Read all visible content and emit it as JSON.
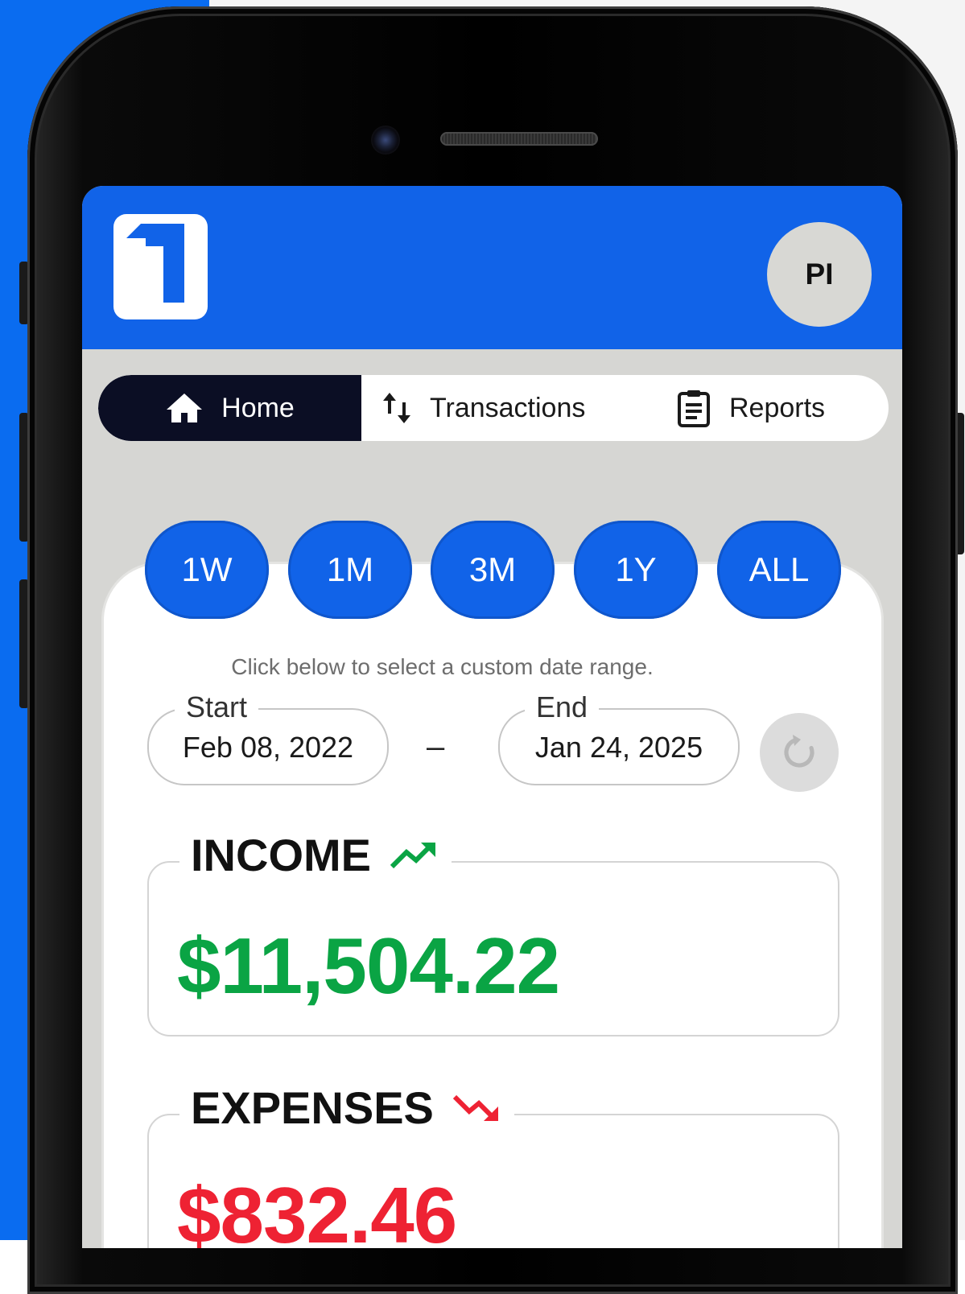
{
  "header": {
    "avatar_initials": "PI"
  },
  "nav": {
    "tabs": [
      {
        "label": "Home",
        "icon": "home-icon",
        "active": true
      },
      {
        "label": "Transactions",
        "icon": "arrows-updown-icon",
        "active": false
      },
      {
        "label": "Reports",
        "icon": "clipboard-icon",
        "active": false
      }
    ]
  },
  "range": {
    "options": [
      "1W",
      "1M",
      "3M",
      "1Y",
      "ALL"
    ]
  },
  "date_range": {
    "hint": "Click below to select a custom date range.",
    "start_label": "Start",
    "start_value": "Feb 08, 2022",
    "separator": "–",
    "end_label": "End",
    "end_value": "Jan 24, 2025"
  },
  "income": {
    "title": "INCOME",
    "value": "$11,504.22",
    "color": "#0aa444",
    "trend_icon": "trending-up-icon"
  },
  "expenses": {
    "title": "EXPENSES",
    "value": "$832.46",
    "color": "#ee2233",
    "trend_icon": "trending-down-icon"
  },
  "colors": {
    "brand_blue": "#1163e8",
    "nav_active": "#0b0e24"
  }
}
